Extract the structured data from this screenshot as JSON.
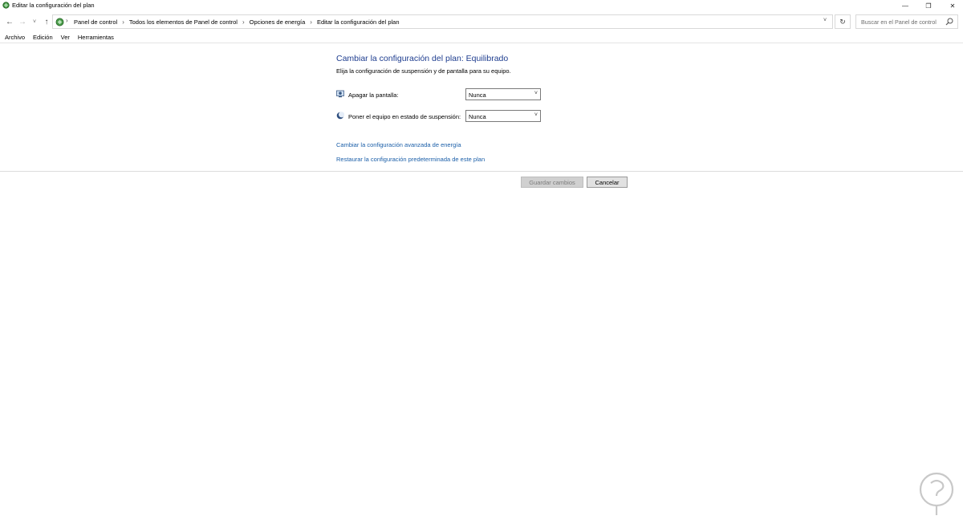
{
  "window": {
    "title": "Editar la configuración del plan",
    "controls": {
      "minimize": "—",
      "restore": "❐",
      "close": "✕"
    }
  },
  "nav": {
    "back": "←",
    "forward": "→",
    "recent": "˅",
    "up": "↑",
    "breadcrumbs": [
      "Panel de control",
      "Todos los elementos de Panel de control",
      "Opciones de energía",
      "Editar la configuración del plan"
    ],
    "separator": "›",
    "dropdown": "˅",
    "refresh": "↻",
    "search_placeholder": "Buscar en el Panel de control"
  },
  "menu": [
    "Archivo",
    "Edición",
    "Ver",
    "Herramientas"
  ],
  "main": {
    "heading": "Cambiar la configuración del plan: Equilibrado",
    "subtitle": "Elija la configuración de suspensión y de pantalla para su equipo.",
    "settings": [
      {
        "label": "Apagar la pantalla:",
        "value": "Nunca",
        "icon": "monitor-icon"
      },
      {
        "label": "Poner el equipo en estado de suspensión:",
        "value": "Nunca",
        "icon": "moon-icon"
      }
    ],
    "links": [
      "Cambiar la configuración avanzada de energía",
      "Restaurar la configuración predeterminada de este plan"
    ],
    "buttons": {
      "save": "Guardar cambios",
      "cancel": "Cancelar"
    }
  },
  "colors": {
    "heading": "#1e3d8f",
    "link": "#1a5ea8",
    "disabled_button": "#d0d0d0"
  }
}
